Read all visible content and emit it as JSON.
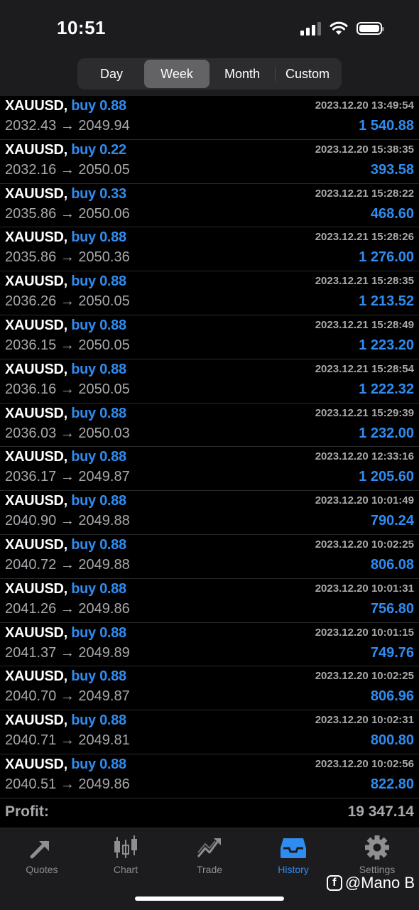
{
  "status_bar": {
    "time": "10:51"
  },
  "period_tabs": [
    "Day",
    "Week",
    "Month",
    "Custom"
  ],
  "period_active": "Week",
  "deals": [
    {
      "symbol": "XAUUSD,",
      "side": "buy 0.88",
      "open": "2032.43",
      "close": "2049.94",
      "time": "2023.12.20 13:49:54",
      "profit": "1 540.88"
    },
    {
      "symbol": "XAUUSD,",
      "side": "buy 0.22",
      "open": "2032.16",
      "close": "2050.05",
      "time": "2023.12.20 15:38:35",
      "profit": "393.58"
    },
    {
      "symbol": "XAUUSD,",
      "side": "buy 0.33",
      "open": "2035.86",
      "close": "2050.06",
      "time": "2023.12.21 15:28:22",
      "profit": "468.60"
    },
    {
      "symbol": "XAUUSD,",
      "side": "buy 0.88",
      "open": "2035.86",
      "close": "2050.36",
      "time": "2023.12.21 15:28:26",
      "profit": "1 276.00"
    },
    {
      "symbol": "XAUUSD,",
      "side": "buy 0.88",
      "open": "2036.26",
      "close": "2050.05",
      "time": "2023.12.21 15:28:35",
      "profit": "1 213.52"
    },
    {
      "symbol": "XAUUSD,",
      "side": "buy 0.88",
      "open": "2036.15",
      "close": "2050.05",
      "time": "2023.12.21 15:28:49",
      "profit": "1 223.20"
    },
    {
      "symbol": "XAUUSD,",
      "side": "buy 0.88",
      "open": "2036.16",
      "close": "2050.05",
      "time": "2023.12.21 15:28:54",
      "profit": "1 222.32"
    },
    {
      "symbol": "XAUUSD,",
      "side": "buy 0.88",
      "open": "2036.03",
      "close": "2050.03",
      "time": "2023.12.21 15:29:39",
      "profit": "1 232.00"
    },
    {
      "symbol": "XAUUSD,",
      "side": "buy 0.88",
      "open": "2036.17",
      "close": "2049.87",
      "time": "2023.12.20 12:33:16",
      "profit": "1 205.60"
    },
    {
      "symbol": "XAUUSD,",
      "side": "buy 0.88",
      "open": "2040.90",
      "close": "2049.88",
      "time": "2023.12.20 10:01:49",
      "profit": "790.24"
    },
    {
      "symbol": "XAUUSD,",
      "side": "buy 0.88",
      "open": "2040.72",
      "close": "2049.88",
      "time": "2023.12.20 10:02:25",
      "profit": "806.08"
    },
    {
      "symbol": "XAUUSD,",
      "side": "buy 0.88",
      "open": "2041.26",
      "close": "2049.86",
      "time": "2023.12.20 10:01:31",
      "profit": "756.80"
    },
    {
      "symbol": "XAUUSD,",
      "side": "buy 0.88",
      "open": "2041.37",
      "close": "2049.89",
      "time": "2023.12.20 10:01:15",
      "profit": "749.76"
    },
    {
      "symbol": "XAUUSD,",
      "side": "buy 0.88",
      "open": "2040.70",
      "close": "2049.87",
      "time": "2023.12.20 10:02:25",
      "profit": "806.96"
    },
    {
      "symbol": "XAUUSD,",
      "side": "buy 0.88",
      "open": "2040.71",
      "close": "2049.81",
      "time": "2023.12.20 10:02:31",
      "profit": "800.80"
    },
    {
      "symbol": "XAUUSD,",
      "side": "buy 0.88",
      "open": "2040.51",
      "close": "2049.86",
      "time": "2023.12.20 10:02:56",
      "profit": "822.80"
    }
  ],
  "arrow": "→",
  "summary": {
    "label": "Profit:",
    "value": "19 347.14"
  },
  "tabbar": [
    {
      "label": "Quotes",
      "icon": "quotes-arrows-icon"
    },
    {
      "label": "Chart",
      "icon": "candlestick-icon"
    },
    {
      "label": "Trade",
      "icon": "trend-line-icon"
    },
    {
      "label": "History",
      "icon": "inbox-tray-icon"
    },
    {
      "label": "Settings",
      "icon": "gear-icon"
    }
  ],
  "tabbar_active": "History",
  "watermark": "@Mano B",
  "colors": {
    "accent": "#2f8cf0",
    "muted": "#a8a8ad",
    "background": "#000000",
    "bar": "#1c1c1e"
  }
}
